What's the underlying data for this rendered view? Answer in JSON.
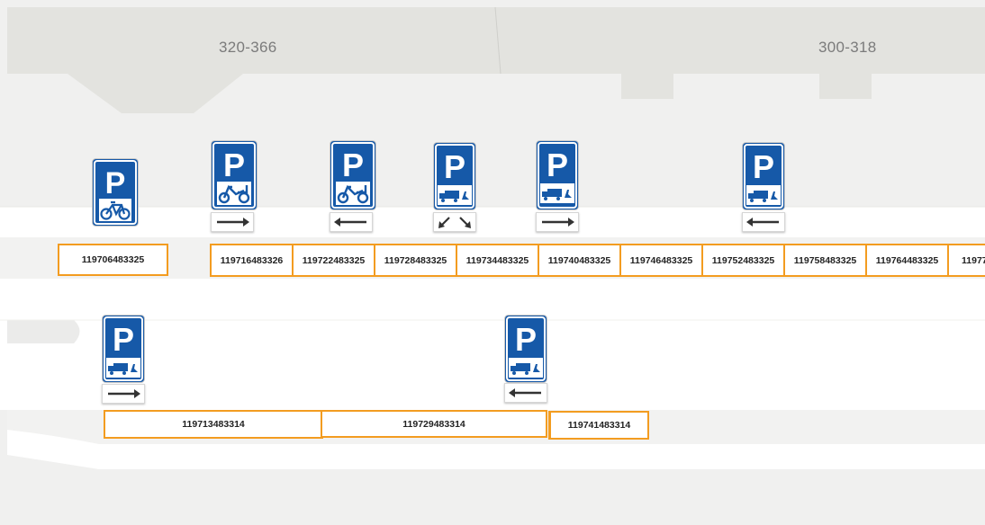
{
  "map": {
    "colors": {
      "background": "#f0f0ef",
      "building": "#e3e3df",
      "road": "#ffffff",
      "parking_border": "#f39c20",
      "sign_blue": "#1659a8"
    },
    "buildings": [
      {
        "label": "320-366"
      },
      {
        "label": "300-318"
      }
    ],
    "parking_spots_upper": [
      {
        "id": "119706483325"
      },
      {
        "id": "119716483326"
      },
      {
        "id": "119722483325"
      },
      {
        "id": "119728483325"
      },
      {
        "id": "119734483325"
      },
      {
        "id": "119740483325"
      },
      {
        "id": "119746483325"
      },
      {
        "id": "119752483325"
      },
      {
        "id": "119758483325"
      },
      {
        "id": "119764483325"
      },
      {
        "id": "11977"
      }
    ],
    "parking_spots_lower": [
      {
        "id": "119713483314"
      },
      {
        "id": "119729483314"
      },
      {
        "id": "119741483314"
      }
    ],
    "signs": [
      {
        "letter": "P",
        "vehicle": "bicycle-icon",
        "arrow": "none"
      },
      {
        "letter": "P",
        "vehicle": "moped-icon",
        "arrow": "right"
      },
      {
        "letter": "P",
        "vehicle": "moped-icon",
        "arrow": "left"
      },
      {
        "letter": "P",
        "vehicle": "loading-truck-icon",
        "arrow": "diverging"
      },
      {
        "letter": "P",
        "vehicle": "loading-truck-icon",
        "arrow": "right"
      },
      {
        "letter": "P",
        "vehicle": "loading-truck-icon",
        "arrow": "left"
      },
      {
        "letter": "P",
        "vehicle": "loading-truck-icon",
        "arrow": "right"
      },
      {
        "letter": "P",
        "vehicle": "loading-truck-icon",
        "arrow": "left"
      }
    ]
  }
}
